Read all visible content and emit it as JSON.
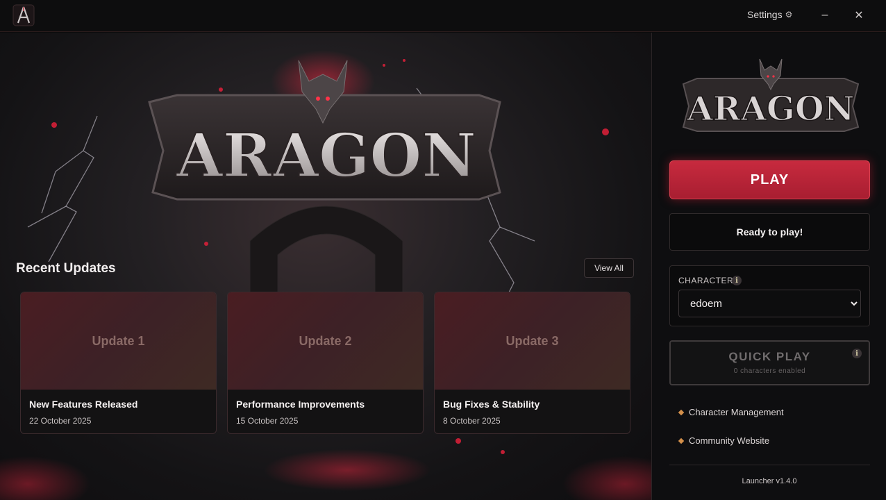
{
  "window": {
    "logo_letter": "A",
    "settings_label": "Settings",
    "settings_icon": "gear-icon",
    "minimize_glyph": "–",
    "close_glyph": "✕"
  },
  "hero": {
    "title": "ARAGON"
  },
  "updates": {
    "heading": "Recent Updates",
    "view_all_label": "View All",
    "cards": [
      {
        "image_label": "Update 1",
        "title": "New Features Released",
        "date": "22 October 2025"
      },
      {
        "image_label": "Update 2",
        "title": "Performance Improvements",
        "date": "15 October 2025"
      },
      {
        "image_label": "Update 3",
        "title": "Bug Fixes & Stability",
        "date": "8 October 2025"
      }
    ]
  },
  "sidebar": {
    "logo_text": "ARAGON",
    "play_label": "PLAY",
    "status_text": "Ready to play!",
    "characters": {
      "label": "CHARACTERS",
      "selected": "edoem"
    },
    "quick_play": {
      "title": "QUICK PLAY",
      "subtitle": "0 characters enabled"
    },
    "links": [
      "Character Management",
      "Community Website"
    ],
    "version": "Launcher v1.4.0"
  },
  "colors": {
    "accent": "#c0253a",
    "link_bullet": "#d4904b"
  }
}
